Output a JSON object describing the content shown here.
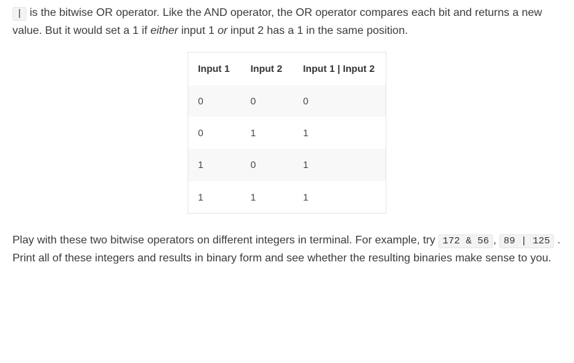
{
  "intro": {
    "code": "|",
    "segment_a": " is the bitwise OR operator. Like the AND operator, the OR operator compares each bit and returns a new value. But it would set a 1 if ",
    "em1": "either",
    "segment_b": " input 1 ",
    "em2": "or",
    "segment_c": " input 2 has a 1 in the same position."
  },
  "table": {
    "headers": [
      "Input 1",
      "Input 2",
      "Input 1 | Input 2"
    ],
    "rows": [
      [
        "0",
        "0",
        "0"
      ],
      [
        "0",
        "1",
        "1"
      ],
      [
        "1",
        "0",
        "1"
      ],
      [
        "1",
        "1",
        "1"
      ]
    ]
  },
  "outro": {
    "segment_a": "Play with these two bitwise operators on different integers in terminal. For example, try ",
    "code1": "172 & 56",
    "comma": ", ",
    "code2": "89 | 125",
    "segment_b": " . Print all of these integers and results in binary form and see whether the resulting binaries make sense to you."
  }
}
